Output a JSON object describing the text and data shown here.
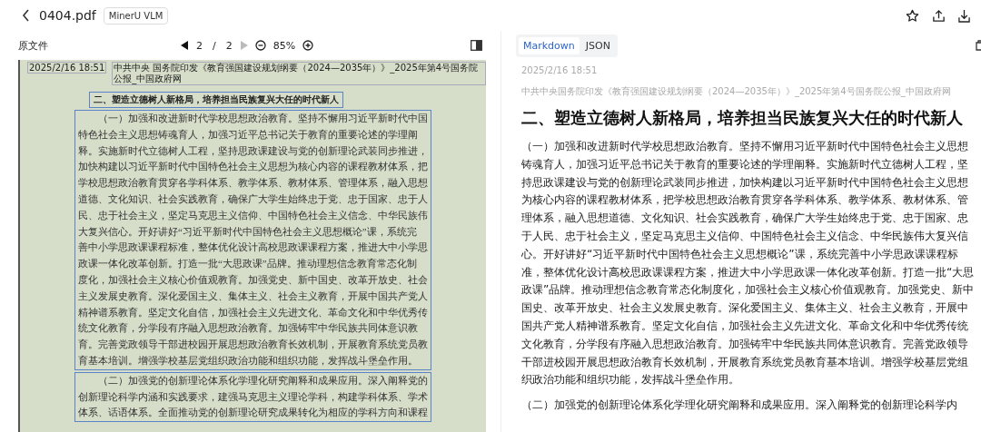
{
  "header": {
    "title": "0404.pdf",
    "badge": "MinerU VLM"
  },
  "toolbar": {
    "label": "原文件",
    "page": "2",
    "separator": "/",
    "total": "2",
    "zoom": "85%",
    "prev_disabled": false,
    "next_disabled": true
  },
  "scan": {
    "date": "2025/2/16 18:51",
    "source": "中共中央 国务院印发《教育强国建设规划纲要（2024—2035年）》_2025年第4号国务院公报_中国政府网",
    "heading": "二、塑造立德树人新格局，培养担当民族复兴大任的时代新人",
    "paragraphs": [
      {
        "lines": [
          "（一）加强和改进新时代学校思想政治教育。坚持不懈用习近平新时代中国",
          "特色社会主义思想铸魂育人，加强习近平总书记关于教育的重要论述的学理阐",
          "释。实施新时代立德树人工程，坚持思政课建设与党的创新理论武装同步推进，",
          "加快构建以习近平新时代中国特色社会主义思想为核心内容的课程教材体系，把",
          "学校思想政治教育贯穿各学科体系、教学体系、教材体系、管理体系，融入思想",
          "道德、文化知识、社会实践教育，确保广大学生始终忠于党、忠于国家、忠于人",
          "民、忠于社会主义，坚定马克思主义信仰、中国特色社会主义信念、中华民族伟",
          "大复兴信心。开好讲好“习近平新时代中国特色社会主义思想概论”课，系统完",
          "善中小学思政课课程标准，整体优化设计高校思政课课程方案，推进大中小学思",
          "政课一体化改革创新。打造一批“大思政课”品牌。推动理想信念教育常态化制",
          "度化，加强社会主义核心价值观教育。加强党史、新中国史、改革开放史、社会",
          "主义发展史教育。深化爱国主义、集体主义、社会主义教育，开展中国共产党人",
          "精神谱系教育。坚定文化自信，加强社会主义先进文化、革命文化和中华优秀传",
          "统文化教育，分学段有序融入思想政治教育。加强铸牢中华民族共同体意识教",
          "育。完善党政领导干部进校园开展思想政治教育长效机制，开展教育系统党员教",
          "育基本培训。增强学校基层党组织政治功能和组织功能，发挥战斗堡垒作用。"
        ]
      },
      {
        "lines": [
          "（二）加强党的创新理论体系化学理化研究阐释和成果应用。深入阐释党的",
          "创新理论科学内涵和实践要求，建强马克思主义理论学科，构建学科体系、学术",
          "体系、话语体系。全面推动党的创新理论研究成果转化为相应的学科方向和课程"
        ]
      }
    ]
  },
  "view_tabs": [
    {
      "label": "Markdown",
      "selected": true
    },
    {
      "label": "JSON",
      "selected": false
    }
  ],
  "markdown": {
    "date": "2025/2/16 18:51",
    "source": "中共中央国务院印发《教育强国建设规划纲要（2024—2035年）》_2025年第4号国务院公报_中国政府网",
    "heading": "二、塑造立德树人新格局，培养担当民族复兴大任的时代新人",
    "paragraphs": [
      "（一）加强和改进新时代学校思想政治教育。坚持不懈用习近平新时代中国特色社会主义思想铸魂育人，加强习近平总书记关于教育的重要论述的学理阐释。实施新时代立德树人工程，坚持思政课建设与党的创新理论武装同步推进，加快构建以习近平新时代中国特色社会主义思想为核心内容的课程教材体系，把学校思想政治教育贯穿各学科体系、教学体系、教材体系、管理体系，融入思想道德、文化知识、社会实践教育，确保广大学生始终忠于党、忠于国家、忠于人民、忠于社会主义，坚定马克思主义信仰、中国特色社会主义信念、中华民族伟大复兴信心。开好讲好“习近平新时代中国特色社会主义思想概论”课，系统完善中小学思政课课程标准，整体优化设计高校思政课课程方案，推进大中小学思政课一体化改革创新。打造一批“大思政课”品牌。推动理想信念教育常态化制度化，加强社会主义核心价值观教育。加强党史、新中国史、改革开放史、社会主义发展史教育。深化爱国主义、集体主义、社会主义教育，开展中国共产党人精神谱系教育。坚定文化自信，加强社会主义先进文化、革命文化和中华优秀传统文化教育，分学段有序融入思想政治教育。加强铸牢中华民族共同体意识教育。完善党政领导干部进校园开展思想政治教育长效机制，开展教育系统党员教育基本培训。增强学校基层党组织政治功能和组织功能，发挥战斗堡垒作用。",
      "（二）加强党的创新理论体系化学理化研究阐释和成果应用。深入阐释党的创新理论科学内"
    ]
  }
}
